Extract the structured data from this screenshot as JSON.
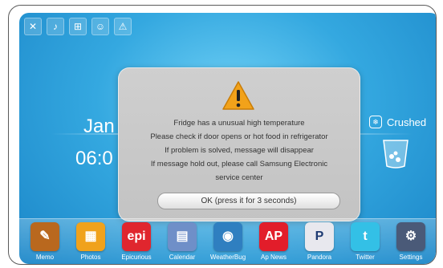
{
  "status_icons": [
    {
      "name": "mute-icon",
      "glyph": "✕"
    },
    {
      "name": "speaker-icon",
      "glyph": "♪"
    },
    {
      "name": "network-icon",
      "glyph": "⊞"
    },
    {
      "name": "people-icon",
      "glyph": "☺"
    },
    {
      "name": "alert-icon",
      "glyph": "⚠"
    }
  ],
  "home": {
    "date": "Jan",
    "time": "06:0",
    "ice_mode": "Crushed"
  },
  "dialog": {
    "lines": [
      "Fridge has a unusual high temperature",
      "Please check if door opens or hot food in refrigerator",
      "If problem is solved, message will disappear",
      "If message hold out, please call Samsung Electronic",
      "service center"
    ],
    "ok_label": "OK (press it for 3 seconds)"
  },
  "dock": [
    {
      "label": "Memo",
      "icon": "memo-icon",
      "text": "✎",
      "color": "#b9681e"
    },
    {
      "label": "Photos",
      "icon": "photos-icon",
      "text": "▦",
      "color": "#f0a21c"
    },
    {
      "label": "Epicurious",
      "icon": "epicurious-icon",
      "text": "epi",
      "color": "#e0262e"
    },
    {
      "label": "Calendar",
      "icon": "calendar-icon",
      "text": "▤",
      "color": "#6f8fc8"
    },
    {
      "label": "WeatherBug",
      "icon": "weatherbug-icon",
      "text": "◉",
      "color": "#2f7fc0"
    },
    {
      "label": "Ap News",
      "icon": "apnews-icon",
      "text": "AP",
      "color": "#e21d2a"
    },
    {
      "label": "Pandora",
      "icon": "pandora-icon",
      "text": "P",
      "color": "#e8e8ee"
    },
    {
      "label": "Twitter",
      "icon": "twitter-icon",
      "text": "t",
      "color": "#33c0e6"
    },
    {
      "label": "Settings",
      "icon": "settings-icon",
      "text": "⚙",
      "color": "#4a5a78"
    }
  ]
}
